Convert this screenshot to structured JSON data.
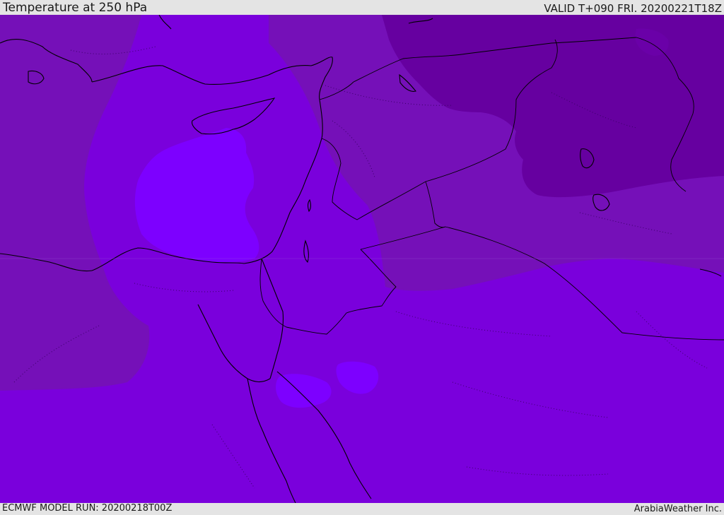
{
  "header": {
    "title": "Temperature at 250 hPa",
    "valid_time": "VALID T+090 FRI. 20200221T18Z"
  },
  "footer": {
    "model_run": "ECMWF MODEL RUN: 20200218T00Z",
    "credit": "ArabiaWeather Inc."
  },
  "map": {
    "field": "Temperature at 250 hPa",
    "colors": {
      "coldest_zone": "#6600a0",
      "cold_zone": "#7510b8",
      "mid_zone": "#7a00dc",
      "warm_zone": "#8000ee",
      "warmest_zone": "#7d00ff",
      "coastline": "#000000"
    }
  }
}
